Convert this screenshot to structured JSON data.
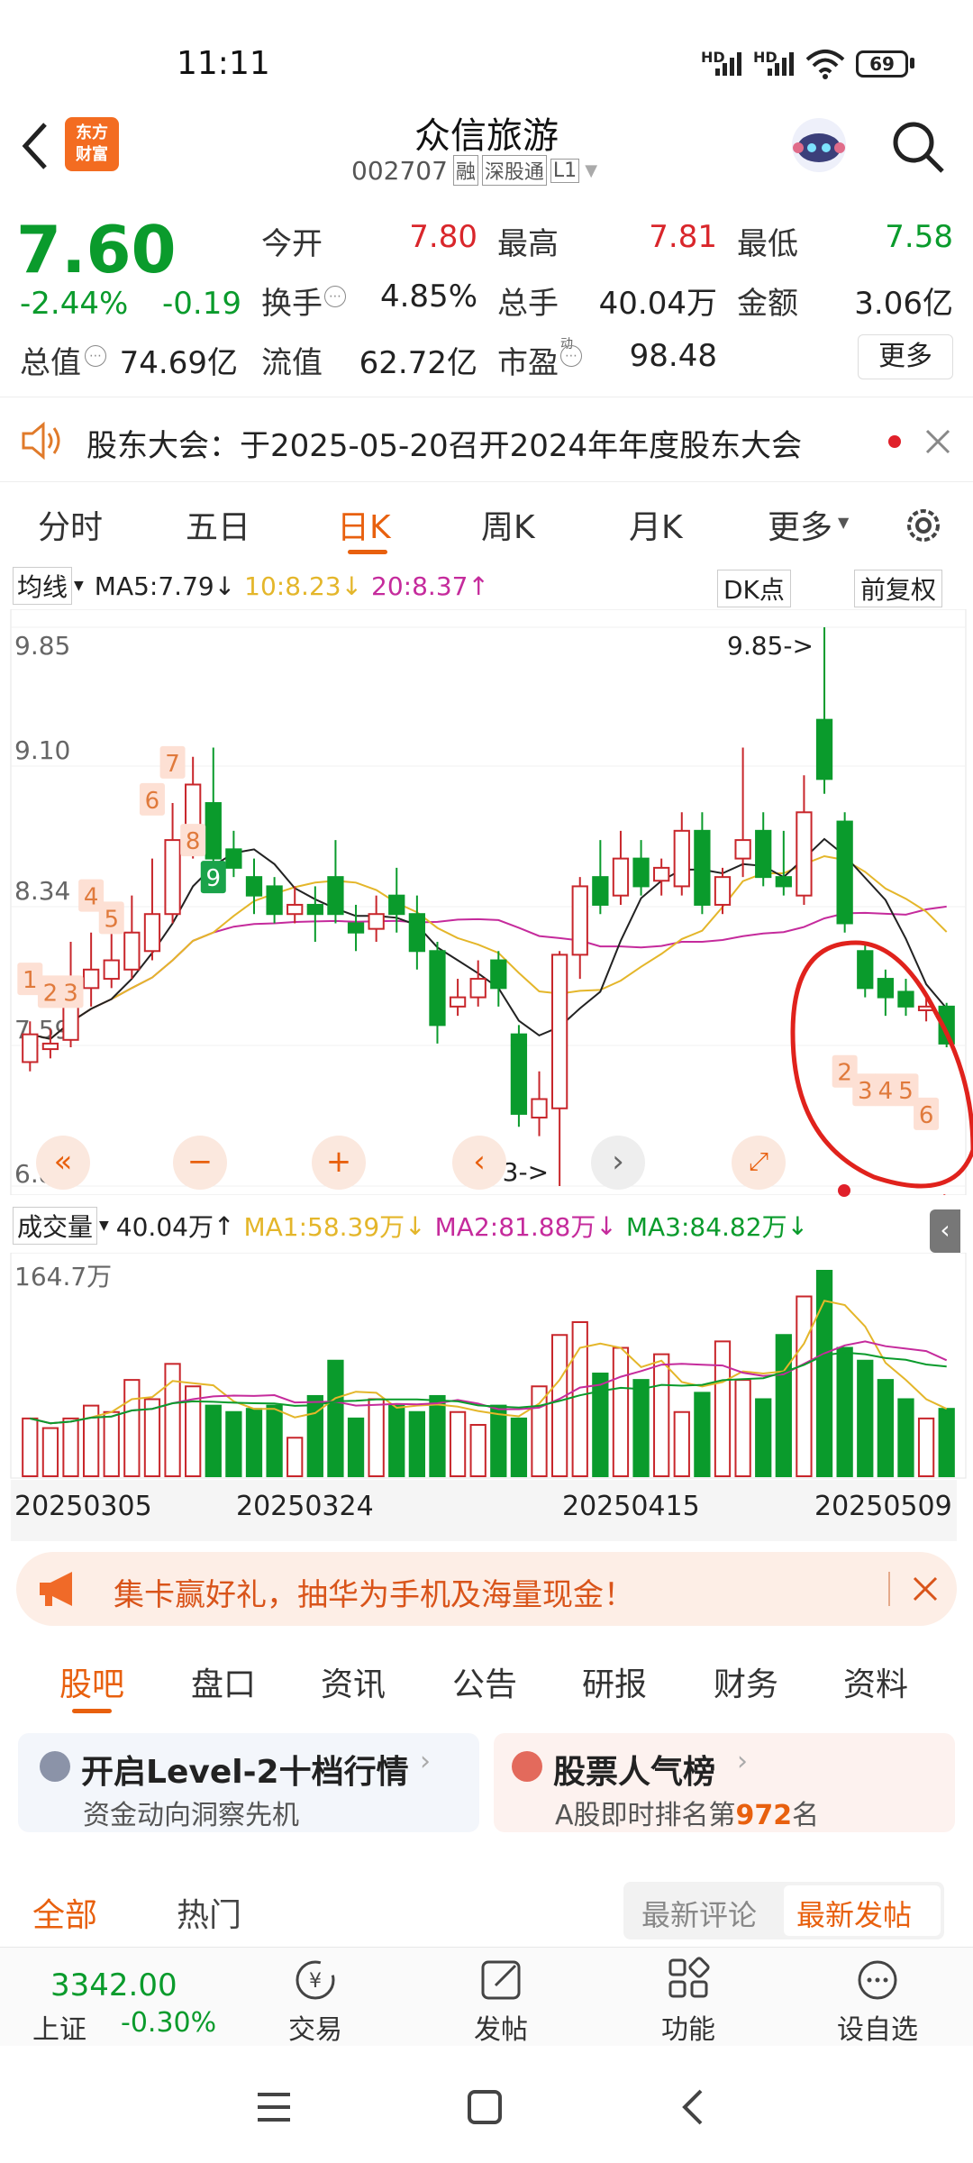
{
  "status": {
    "time": "11:11",
    "net1": "HD",
    "net2": "HD",
    "battery": "69"
  },
  "header": {
    "logo": "东方\n财富",
    "logo_l1": "东方",
    "logo_l2": "财富",
    "title": "众信旅游",
    "code": "002707",
    "tag1": "融",
    "tag2": "深股通",
    "tag3": "L1"
  },
  "quote": {
    "price": "7.60",
    "pct": "-2.44%",
    "chg": "-0.19",
    "open_label": "今开",
    "open": "7.80",
    "high_label": "最高",
    "high": "7.81",
    "low_label": "最低",
    "low": "7.58",
    "turnover_label": "换手",
    "turnover": "4.85%",
    "vol_label": "总手",
    "vol": "40.04万",
    "amount_label": "金额",
    "amount": "3.06亿",
    "mcap_label": "总值",
    "mcap": "74.69亿",
    "float_label": "流值",
    "float": "62.72亿",
    "pe_label": "市盈",
    "pe_sup": "动",
    "pe": "98.48",
    "more": "更多"
  },
  "notice": {
    "text": "股东大会：于2025-05-20召开2024年年度股东大会"
  },
  "ktabs": [
    "分时",
    "五日",
    "日K",
    "周K",
    "月K",
    "更多"
  ],
  "ma": {
    "sel": "均线",
    "ma5": "MA5:7.79",
    "ma10": "10:8.23",
    "ma20": "20:8.37",
    "dk": "DK点",
    "fq": "前复权"
  },
  "chart_labels": {
    "p1": "9.85",
    "p2": "9.10",
    "p3": "8.34",
    "p4": "7.59",
    "p5": "6.83",
    "hi": "9.85->",
    "lo": "6.83->"
  },
  "vol_bar": {
    "sel": "成交量",
    "vol": "40.04万",
    "ma1": "MA1:58.39万",
    "ma2": "MA2:81.88万",
    "ma3": "MA3:84.82万",
    "max": "164.7万"
  },
  "dates": [
    "20250305",
    "20250324",
    "20250415",
    "20250509"
  ],
  "chart_data": {
    "type": "candlestick",
    "ylim": [
      6.83,
      9.85
    ],
    "candles": [
      {
        "o": 7.5,
        "c": 7.65,
        "h": 7.72,
        "l": 7.45
      },
      {
        "o": 7.57,
        "c": 7.6,
        "h": 7.68,
        "l": 7.52
      },
      {
        "o": 7.62,
        "c": 7.9,
        "h": 8.15,
        "l": 7.58
      },
      {
        "o": 7.9,
        "c": 8.0,
        "h": 8.2,
        "l": 7.8
      },
      {
        "o": 7.95,
        "c": 8.05,
        "h": 8.3,
        "l": 7.9
      },
      {
        "o": 8.0,
        "c": 8.2,
        "h": 8.4,
        "l": 7.95
      },
      {
        "o": 8.1,
        "c": 8.3,
        "h": 8.6,
        "l": 8.05
      },
      {
        "o": 8.3,
        "c": 8.7,
        "h": 8.9,
        "l": 8.25
      },
      {
        "o": 8.7,
        "c": 9.0,
        "h": 9.15,
        "l": 8.6
      },
      {
        "o": 8.9,
        "c": 8.6,
        "h": 9.2,
        "l": 8.55
      },
      {
        "o": 8.65,
        "c": 8.55,
        "h": 8.75,
        "l": 8.5
      },
      {
        "o": 8.5,
        "c": 8.4,
        "h": 8.6,
        "l": 8.3
      },
      {
        "o": 8.45,
        "c": 8.3,
        "h": 8.5,
        "l": 8.25
      },
      {
        "o": 8.3,
        "c": 8.35,
        "h": 8.45,
        "l": 8.25
      },
      {
        "o": 8.35,
        "c": 8.3,
        "h": 8.45,
        "l": 8.15
      },
      {
        "o": 8.5,
        "c": 8.3,
        "h": 8.7,
        "l": 8.25
      },
      {
        "o": 8.25,
        "c": 8.2,
        "h": 8.35,
        "l": 8.1
      },
      {
        "o": 8.22,
        "c": 8.3,
        "h": 8.4,
        "l": 8.15
      },
      {
        "o": 8.4,
        "c": 8.3,
        "h": 8.55,
        "l": 8.2
      },
      {
        "o": 8.3,
        "c": 8.1,
        "h": 8.4,
        "l": 8.0
      },
      {
        "o": 8.1,
        "c": 7.7,
        "h": 8.15,
        "l": 7.6
      },
      {
        "o": 7.8,
        "c": 7.85,
        "h": 7.95,
        "l": 7.75
      },
      {
        "o": 7.85,
        "c": 7.95,
        "h": 8.05,
        "l": 7.8
      },
      {
        "o": 8.05,
        "c": 7.9,
        "h": 8.1,
        "l": 7.8
      },
      {
        "o": 7.65,
        "c": 7.22,
        "h": 7.7,
        "l": 7.15
      },
      {
        "o": 7.2,
        "c": 7.3,
        "h": 7.45,
        "l": 7.1
      },
      {
        "o": 7.25,
        "c": 8.08,
        "h": 8.1,
        "l": 6.83
      },
      {
        "o": 8.08,
        "c": 8.45,
        "h": 8.5,
        "l": 7.95
      },
      {
        "o": 8.5,
        "c": 8.35,
        "h": 8.7,
        "l": 8.3
      },
      {
        "o": 8.4,
        "c": 8.6,
        "h": 8.75,
        "l": 8.35
      },
      {
        "o": 8.6,
        "c": 8.45,
        "h": 8.7,
        "l": 8.4
      },
      {
        "o": 8.48,
        "c": 8.55,
        "h": 8.6,
        "l": 8.4
      },
      {
        "o": 8.45,
        "c": 8.75,
        "h": 8.85,
        "l": 8.4
      },
      {
        "o": 8.75,
        "c": 8.35,
        "h": 8.85,
        "l": 8.3
      },
      {
        "o": 8.35,
        "c": 8.5,
        "h": 8.55,
        "l": 8.3
      },
      {
        "o": 8.6,
        "c": 8.7,
        "h": 9.2,
        "l": 8.5
      },
      {
        "o": 8.75,
        "c": 8.5,
        "h": 8.85,
        "l": 8.45
      },
      {
        "o": 8.5,
        "c": 8.45,
        "h": 8.75,
        "l": 8.4
      },
      {
        "o": 8.4,
        "c": 8.85,
        "h": 9.05,
        "l": 8.35
      },
      {
        "o": 9.35,
        "c": 9.03,
        "h": 9.85,
        "l": 8.95
      },
      {
        "o": 8.8,
        "c": 8.25,
        "h": 8.85,
        "l": 8.2
      },
      {
        "o": 8.1,
        "c": 7.9,
        "h": 8.15,
        "l": 7.85
      },
      {
        "o": 7.95,
        "c": 7.85,
        "h": 8.0,
        "l": 7.75
      },
      {
        "o": 7.88,
        "c": 7.8,
        "h": 7.95,
        "l": 7.75
      },
      {
        "o": 7.78,
        "c": 7.8,
        "h": 7.85,
        "l": 7.72
      },
      {
        "o": 7.8,
        "c": 7.6,
        "h": 7.82,
        "l": 7.58
      }
    ],
    "volume": [
      18,
      15,
      18,
      22,
      20,
      30,
      24,
      35,
      28,
      22,
      20,
      21,
      22,
      12,
      25,
      36,
      18,
      24,
      22,
      20,
      25,
      20,
      16,
      22,
      18,
      28,
      44,
      48,
      32,
      40,
      30,
      38,
      20,
      26,
      42,
      30,
      24,
      44,
      56,
      64,
      40,
      36,
      30,
      24,
      18,
      21
    ],
    "candle_labels": [
      "1",
      "2",
      "3",
      "4",
      "5",
      "6",
      "7",
      "8",
      "9",
      "2",
      "3",
      "4",
      "5",
      "6"
    ]
  },
  "promo": {
    "text": "集卡赢好礼，抽华为手机及海量现金！"
  },
  "subtabs": [
    "股吧",
    "盘口",
    "资讯",
    "公告",
    "研报",
    "财务",
    "资料"
  ],
  "card1": {
    "title": "开启Level-2十档行情",
    "sub": "资金动向洞察先机"
  },
  "card2": {
    "title": "股票人气榜",
    "sub_pre": "A股即时排名第",
    "rank": "972",
    "sub_post": "名"
  },
  "filter": {
    "all": "全部",
    "hot": "热门",
    "latest_comment": "最新评论",
    "latest_post": "最新发帖"
  },
  "bottom": {
    "index_val": "3342.00",
    "index_name": "上证",
    "index_pct": "-0.30%",
    "trade": "交易",
    "post": "发帖",
    "func": "功能",
    "watch": "设自选"
  }
}
